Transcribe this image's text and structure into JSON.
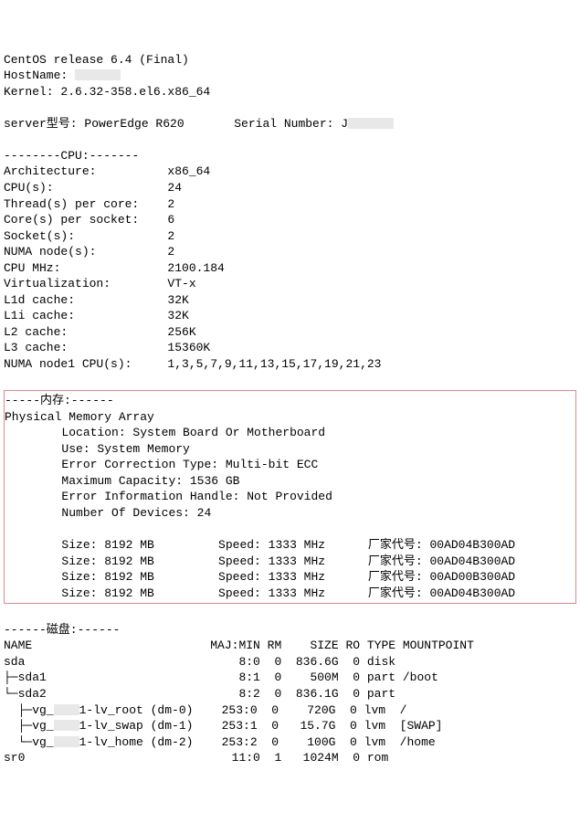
{
  "header": {
    "os_line": "CentOS release 6.4 (Final)",
    "hostname_label": "HostName: ",
    "kernel_line": "Kernel: 2.6.32-358.el6.x86_64",
    "server_model_label": "server型号: ",
    "server_model": "PowerEdge R620",
    "serial_label": "Serial Number: J"
  },
  "cpu": {
    "title": "--------CPU:-------",
    "rows": [
      [
        "Architecture:",
        "x86_64"
      ],
      [
        "CPU(s):",
        "24"
      ],
      [
        "Thread(s) per core:",
        "2"
      ],
      [
        "Core(s) per socket:",
        "6"
      ],
      [
        "Socket(s):",
        "2"
      ],
      [
        "NUMA node(s):",
        "2"
      ],
      [
        "CPU MHz:",
        "2100.184"
      ],
      [
        "Virtualization:",
        "VT-x"
      ],
      [
        "L1d cache:",
        "32K"
      ],
      [
        "L1i cache:",
        "32K"
      ],
      [
        "L2 cache:",
        "256K"
      ],
      [
        "L3 cache:",
        "15360K"
      ],
      [
        "NUMA node1 CPU(s):",
        "1,3,5,7,9,11,13,15,17,19,21,23"
      ]
    ]
  },
  "mem": {
    "title": "-----内存:------",
    "array_title": "Physical Memory Array",
    "location": "Location: System Board Or Motherboard",
    "use": "Use: System Memory",
    "ecc": "Error Correction Type: Multi-bit ECC",
    "max_cap": "Maximum Capacity: 1536 GB",
    "err_handle": "Error Information Handle: Not Provided",
    "num_dev": "Number Of Devices: 24",
    "dimms": [
      {
        "size": "Size: 8192 MB",
        "speed": "Speed: 1333 MHz",
        "vendor": "厂家代号: 00AD04B300AD"
      },
      {
        "size": "Size: 8192 MB",
        "speed": "Speed: 1333 MHz",
        "vendor": "厂家代号: 00AD04B300AD"
      },
      {
        "size": "Size: 8192 MB",
        "speed": "Speed: 1333 MHz",
        "vendor": "厂家代号: 00AD00B300AD"
      },
      {
        "size": "Size: 8192 MB",
        "speed": "Speed: 1333 MHz",
        "vendor": "厂家代号: 00AD04B300AD"
      }
    ]
  },
  "disk": {
    "title": "------磁盘:------",
    "header": [
      "NAME",
      "MAJ:MIN",
      "RM",
      "SIZE",
      "RO",
      "TYPE",
      "MOUNTPOINT"
    ],
    "rows": [
      {
        "name": "sda",
        "maj": "8:0",
        "rm": "0",
        "size": "836.6G",
        "ro": "0",
        "type": "disk",
        "mp": ""
      },
      {
        "name": "├─sda1",
        "maj": "8:1",
        "rm": "0",
        "size": "500M",
        "ro": "0",
        "type": "part",
        "mp": "/boot"
      },
      {
        "name": "└─sda2",
        "maj": "8:2",
        "rm": "0",
        "size": "836.1G",
        "ro": "0",
        "type": "part",
        "mp": ""
      },
      {
        "name": "  ├─vg_███1-lv_root (dm-0)",
        "maj": "253:0",
        "rm": "0",
        "size": "720G",
        "ro": "0",
        "type": "lvm",
        "mp": "/"
      },
      {
        "name": "  ├─vg_███1-lv_swap (dm-1)",
        "maj": "253:1",
        "rm": "0",
        "size": "15.7G",
        "ro": "0",
        "type": "lvm",
        "mp": "[SWAP]"
      },
      {
        "name": "  └─vg_███1-lv_home (dm-2)",
        "maj": "253:2",
        "rm": "0",
        "size": "100G",
        "ro": "0",
        "type": "lvm",
        "mp": "/home"
      },
      {
        "name": "sr0",
        "maj": "11:0",
        "rm": "1",
        "size": "1024M",
        "ro": "0",
        "type": "rom",
        "mp": ""
      }
    ]
  }
}
